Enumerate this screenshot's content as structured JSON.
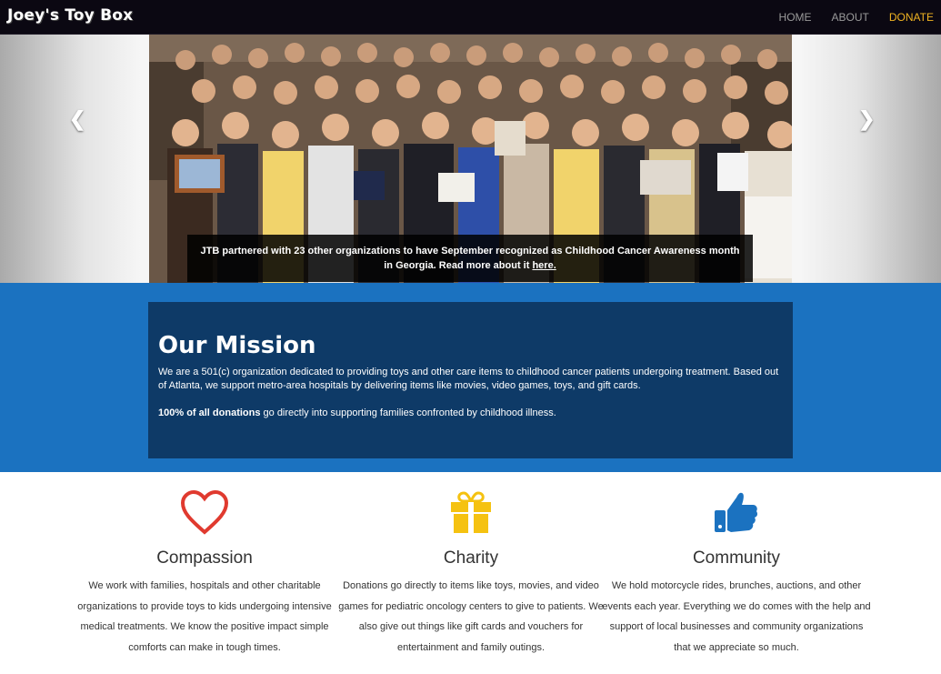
{
  "navbar": {
    "brand": "Joey's Toy Box",
    "links": [
      {
        "label": "HOME"
      },
      {
        "label": "ABOUT"
      },
      {
        "label": "DONATE",
        "active_color": "#f0b322"
      }
    ]
  },
  "carousel": {
    "prev_icon": "chevron-left-icon",
    "next_icon": "chevron-right-icon",
    "caption_text": "JTB partnered with 23 other organizations to have September recognized as Childhood Cancer Awareness month in Georgia. Read more about it ",
    "caption_link": "here."
  },
  "mission": {
    "title": "Our Mission",
    "text": "We are a 501(c) organization dedicated to providing toys and other care items to childhood cancer patients undergoing treatment. Based out of Atlanta, we support metro-area hospitals by delivering items like movies, video games, toys, and gift cards.",
    "donations_bold": "100% of all donations",
    "donations_rest": " go directly into supporting families confronted by childhood illness.",
    "band_color": "#1b72c0",
    "box_color": "#0e3a67"
  },
  "features": [
    {
      "icon": "heart-icon",
      "color": "#e03a2f",
      "title": "Compassion",
      "text": "We work with families, hospitals and other charitable organizations to provide toys to kids undergoing intensive medical treatments. We know the positive impact simple comforts can make in tough times."
    },
    {
      "icon": "gift-icon",
      "color": "#f5c211",
      "title": "Charity",
      "text": "Donations go directly to items like toys, movies, and video games for pediatric oncology centers to give to patients. We also give out things like gift cards and vouchers for entertainment and family outings."
    },
    {
      "icon": "thumbs-up-icon",
      "color": "#1b72c0",
      "title": "Community",
      "text": "We hold motorcycle rides, brunches, auctions, and other events each year. Everything we do comes with the help and support of local businesses and community organizations that we appreciate so much."
    }
  ]
}
